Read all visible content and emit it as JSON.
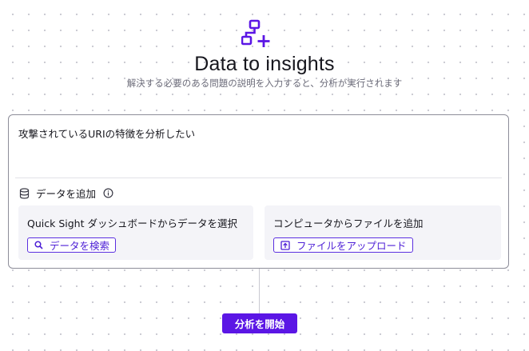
{
  "header": {
    "icon": "workflow-diagram-plus-icon",
    "title": "Data to insights",
    "subtitle": "解決する必要のある問題の説明を入力すると、分析が実行されます"
  },
  "prompt": {
    "value": "攻撃されているURIの特徴を分析したい"
  },
  "add_data": {
    "icon": "database-icon",
    "label": "データを追加",
    "info_icon": "info-icon"
  },
  "cards": [
    {
      "title": "Quick Sight ダッシュボードからデータを選択",
      "button_label": "データを検索",
      "button_icon": "search-icon"
    },
    {
      "title": "コンピュータからファイルを追加",
      "button_label": "ファイルをアップロード",
      "button_icon": "upload-icon"
    }
  ],
  "actions": {
    "start_label": "分析を開始"
  },
  "colors": {
    "accent": "#5b16e5",
    "border": "#8d8d99",
    "card_bg": "#f4f4f8"
  }
}
